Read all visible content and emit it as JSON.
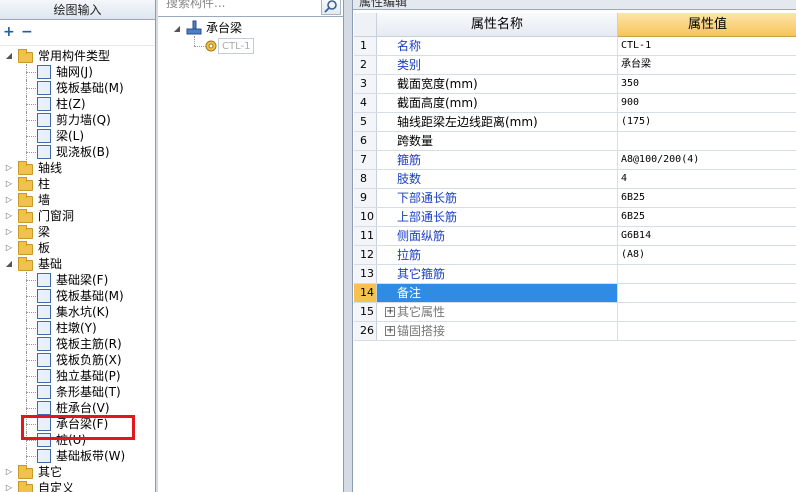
{
  "left_panel": {
    "title": "绘图输入",
    "toolbar": {
      "expand": "+",
      "collapse": "−"
    },
    "tree": [
      {
        "label": "常用构件类型",
        "level": 0,
        "expanded": true
      },
      {
        "label": "轴网(J)",
        "level": 1,
        "icon": "axis-grid-icon"
      },
      {
        "label": "筏板基础(M)",
        "level": 1,
        "icon": "raft-foundation-icon"
      },
      {
        "label": "柱(Z)",
        "level": 1,
        "icon": "column-icon"
      },
      {
        "label": "剪力墙(Q)",
        "level": 1,
        "icon": "shear-wall-icon"
      },
      {
        "label": "梁(L)",
        "level": 1,
        "icon": "beam-icon"
      },
      {
        "label": "现浇板(B)",
        "level": 1,
        "icon": "slab-icon"
      },
      {
        "label": "轴线",
        "level": 0,
        "expanded": false
      },
      {
        "label": "柱",
        "level": 0,
        "expanded": false
      },
      {
        "label": "墙",
        "level": 0,
        "expanded": false
      },
      {
        "label": "门窗洞",
        "level": 0,
        "expanded": false
      },
      {
        "label": "梁",
        "level": 0,
        "expanded": false
      },
      {
        "label": "板",
        "level": 0,
        "expanded": false
      },
      {
        "label": "基础",
        "level": 0,
        "expanded": true
      },
      {
        "label": "基础梁(F)",
        "level": 1,
        "icon": "foundation-beam-icon"
      },
      {
        "label": "筏板基础(M)",
        "level": 1,
        "icon": "raft-foundation-icon"
      },
      {
        "label": "集水坑(K)",
        "level": 1,
        "icon": "sump-pit-icon"
      },
      {
        "label": "柱墩(Y)",
        "level": 1,
        "icon": "column-pier-icon"
      },
      {
        "label": "筏板主筋(R)",
        "level": 1,
        "icon": "raft-main-rebar-icon"
      },
      {
        "label": "筏板负筋(X)",
        "level": 1,
        "icon": "raft-negative-rebar-icon"
      },
      {
        "label": "独立基础(P)",
        "level": 1,
        "icon": "isolated-footing-icon"
      },
      {
        "label": "条形基础(T)",
        "level": 1,
        "icon": "strip-footing-icon"
      },
      {
        "label": "桩承台(V)",
        "level": 1,
        "icon": "pile-cap-icon"
      },
      {
        "label": "承台梁(F)",
        "level": 1,
        "icon": "cap-beam-icon",
        "selected": true
      },
      {
        "label": "桩(U)",
        "level": 1,
        "icon": "pile-icon"
      },
      {
        "label": "基础板带(W)",
        "level": 1,
        "icon": "foundation-strip-icon"
      },
      {
        "label": "其它",
        "level": 0,
        "expanded": false
      },
      {
        "label": "自定义",
        "level": 0,
        "expanded": false
      }
    ]
  },
  "middle_panel": {
    "search_placeholder": "搜索构件...",
    "tree_root": "承台梁",
    "tree_child": "CTL-1"
  },
  "right_panel": {
    "tab_label": "属性编辑",
    "headers": {
      "name": "属性名称",
      "value": "属性值"
    },
    "rows": [
      {
        "num": "1",
        "name": "名称",
        "value": "CTL-1",
        "color": "blue"
      },
      {
        "num": "2",
        "name": "类别",
        "value": "承台梁",
        "color": "blue"
      },
      {
        "num": "3",
        "name": "截面宽度(mm)",
        "value": "350",
        "color": "black"
      },
      {
        "num": "4",
        "name": "截面高度(mm)",
        "value": "900",
        "color": "black"
      },
      {
        "num": "5",
        "name": "轴线距梁左边线距离(mm)",
        "value": "(175)",
        "color": "black"
      },
      {
        "num": "6",
        "name": "跨数量",
        "value": "",
        "color": "black"
      },
      {
        "num": "7",
        "name": "箍筋",
        "value": "A8@100/200(4)",
        "color": "blue"
      },
      {
        "num": "8",
        "name": "肢数",
        "value": "4",
        "color": "blue"
      },
      {
        "num": "9",
        "name": "下部通长筋",
        "value": "6B25",
        "color": "blue"
      },
      {
        "num": "10",
        "name": "上部通长筋",
        "value": "6B25",
        "color": "blue"
      },
      {
        "num": "11",
        "name": "侧面纵筋",
        "value": "G6B14",
        "color": "blue"
      },
      {
        "num": "12",
        "name": "拉筋",
        "value": "(A8)",
        "color": "blue"
      },
      {
        "num": "13",
        "name": "其它箍筋",
        "value": "",
        "color": "blue"
      },
      {
        "num": "14",
        "name": "备注",
        "value": "",
        "color": "black",
        "selected": true
      },
      {
        "num": "15",
        "name": "其它属性",
        "value": "",
        "color": "gray",
        "group": true
      },
      {
        "num": "26",
        "name": "锚固搭接",
        "value": "",
        "color": "gray",
        "group": true
      }
    ]
  },
  "colors": {
    "highlight_box": "#e4161d",
    "selected_row": "#2f8be3",
    "value_header": "#f7c45a",
    "blue_text": "#1a3fc4"
  }
}
